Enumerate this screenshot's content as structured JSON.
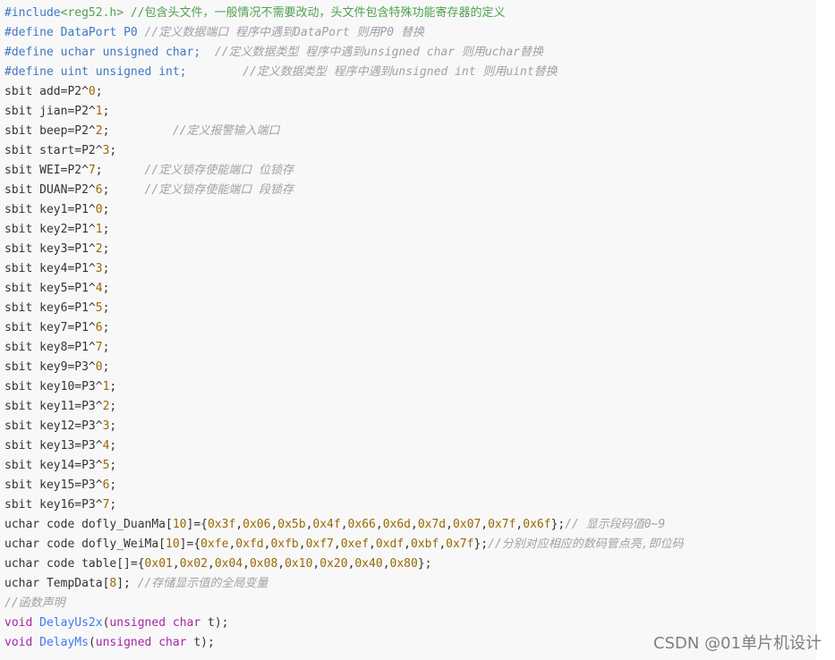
{
  "code_lines": [
    [
      {
        "t": "#include",
        "c": "dir"
      },
      {
        "t": "<reg52.h>",
        "c": "str"
      },
      {
        "t": " //包含头文件，一般情况不需要改动，头文件包含特殊功能寄存器的定义",
        "c": "str"
      }
    ],
    [
      {
        "t": "#define",
        "c": "dir"
      },
      {
        "t": " DataPort P0 ",
        "c": "kw"
      },
      {
        "t": "//定义数据端口 程序中遇到DataPort 则用P0 替换",
        "c": "cmt"
      }
    ],
    [
      {
        "t": "#define",
        "c": "dir"
      },
      {
        "t": " uchar unsigned char;",
        "c": "kw"
      },
      {
        "t": "  //定义数据类型 程序中遇到unsigned char 则用uchar替换",
        "c": "cmt"
      }
    ],
    [
      {
        "t": "#define",
        "c": "dir"
      },
      {
        "t": " uint unsigned int;",
        "c": "kw"
      },
      {
        "t": "        //定义数据类型 程序中遇到unsigned int 则用uint替换",
        "c": "cmt"
      }
    ],
    [
      {
        "t": "sbit add=P2^",
        "c": "sym"
      },
      {
        "t": "0",
        "c": "num"
      },
      {
        "t": ";",
        "c": "sym"
      }
    ],
    [
      {
        "t": "sbit jian=P2^",
        "c": "sym"
      },
      {
        "t": "1",
        "c": "num"
      },
      {
        "t": ";",
        "c": "sym"
      }
    ],
    [
      {
        "t": "sbit beep=P2^",
        "c": "sym"
      },
      {
        "t": "2",
        "c": "num"
      },
      {
        "t": ";",
        "c": "sym"
      },
      {
        "t": "         //定义报警输入端口",
        "c": "cmt"
      }
    ],
    [
      {
        "t": "sbit start=P2^",
        "c": "sym"
      },
      {
        "t": "3",
        "c": "num"
      },
      {
        "t": ";",
        "c": "sym"
      }
    ],
    [
      {
        "t": "sbit WEI=P2^",
        "c": "sym"
      },
      {
        "t": "7",
        "c": "num"
      },
      {
        "t": ";",
        "c": "sym"
      },
      {
        "t": "      //定义锁存使能端口 位锁存",
        "c": "cmt"
      }
    ],
    [
      {
        "t": "sbit DUAN=P2^",
        "c": "sym"
      },
      {
        "t": "6",
        "c": "num"
      },
      {
        "t": ";",
        "c": "sym"
      },
      {
        "t": "     //定义锁存使能端口 段锁存",
        "c": "cmt"
      }
    ],
    [
      {
        "t": "sbit key1=P1^",
        "c": "sym"
      },
      {
        "t": "0",
        "c": "num"
      },
      {
        "t": ";",
        "c": "sym"
      }
    ],
    [
      {
        "t": "sbit key2=P1^",
        "c": "sym"
      },
      {
        "t": "1",
        "c": "num"
      },
      {
        "t": ";",
        "c": "sym"
      }
    ],
    [
      {
        "t": "sbit key3=P1^",
        "c": "sym"
      },
      {
        "t": "2",
        "c": "num"
      },
      {
        "t": ";",
        "c": "sym"
      }
    ],
    [
      {
        "t": "sbit key4=P1^",
        "c": "sym"
      },
      {
        "t": "3",
        "c": "num"
      },
      {
        "t": ";",
        "c": "sym"
      }
    ],
    [
      {
        "t": "sbit key5=P1^",
        "c": "sym"
      },
      {
        "t": "4",
        "c": "num"
      },
      {
        "t": ";",
        "c": "sym"
      }
    ],
    [
      {
        "t": "sbit key6=P1^",
        "c": "sym"
      },
      {
        "t": "5",
        "c": "num"
      },
      {
        "t": ";",
        "c": "sym"
      }
    ],
    [
      {
        "t": "sbit key7=P1^",
        "c": "sym"
      },
      {
        "t": "6",
        "c": "num"
      },
      {
        "t": ";",
        "c": "sym"
      }
    ],
    [
      {
        "t": "sbit key8=P1^",
        "c": "sym"
      },
      {
        "t": "7",
        "c": "num"
      },
      {
        "t": ";",
        "c": "sym"
      }
    ],
    [
      {
        "t": "sbit key9=P3^",
        "c": "sym"
      },
      {
        "t": "0",
        "c": "num"
      },
      {
        "t": ";",
        "c": "sym"
      }
    ],
    [
      {
        "t": "sbit key10=P3^",
        "c": "sym"
      },
      {
        "t": "1",
        "c": "num"
      },
      {
        "t": ";",
        "c": "sym"
      }
    ],
    [
      {
        "t": "sbit key11=P3^",
        "c": "sym"
      },
      {
        "t": "2",
        "c": "num"
      },
      {
        "t": ";",
        "c": "sym"
      }
    ],
    [
      {
        "t": "sbit key12=P3^",
        "c": "sym"
      },
      {
        "t": "3",
        "c": "num"
      },
      {
        "t": ";",
        "c": "sym"
      }
    ],
    [
      {
        "t": "sbit key13=P3^",
        "c": "sym"
      },
      {
        "t": "4",
        "c": "num"
      },
      {
        "t": ";",
        "c": "sym"
      }
    ],
    [
      {
        "t": "sbit key14=P3^",
        "c": "sym"
      },
      {
        "t": "5",
        "c": "num"
      },
      {
        "t": ";",
        "c": "sym"
      }
    ],
    [
      {
        "t": "sbit key15=P3^",
        "c": "sym"
      },
      {
        "t": "6",
        "c": "num"
      },
      {
        "t": ";",
        "c": "sym"
      }
    ],
    [
      {
        "t": "sbit key16=P3^",
        "c": "sym"
      },
      {
        "t": "7",
        "c": "num"
      },
      {
        "t": ";",
        "c": "sym"
      }
    ],
    [
      {
        "t": "uchar code dofly_DuanMa[",
        "c": "sym"
      },
      {
        "t": "10",
        "c": "num"
      },
      {
        "t": "]={",
        "c": "sym"
      },
      {
        "t": "0x3f",
        "c": "num"
      },
      {
        "t": ",",
        "c": "sym"
      },
      {
        "t": "0x06",
        "c": "num"
      },
      {
        "t": ",",
        "c": "sym"
      },
      {
        "t": "0x5b",
        "c": "num"
      },
      {
        "t": ",",
        "c": "sym"
      },
      {
        "t": "0x4f",
        "c": "num"
      },
      {
        "t": ",",
        "c": "sym"
      },
      {
        "t": "0x66",
        "c": "num"
      },
      {
        "t": ",",
        "c": "sym"
      },
      {
        "t": "0x6d",
        "c": "num"
      },
      {
        "t": ",",
        "c": "sym"
      },
      {
        "t": "0x7d",
        "c": "num"
      },
      {
        "t": ",",
        "c": "sym"
      },
      {
        "t": "0x07",
        "c": "num"
      },
      {
        "t": ",",
        "c": "sym"
      },
      {
        "t": "0x7f",
        "c": "num"
      },
      {
        "t": ",",
        "c": "sym"
      },
      {
        "t": "0x6f",
        "c": "num"
      },
      {
        "t": "};",
        "c": "sym"
      },
      {
        "t": "// 显示段码值0~9",
        "c": "cmt"
      }
    ],
    [
      {
        "t": "uchar code dofly_WeiMa[",
        "c": "sym"
      },
      {
        "t": "10",
        "c": "num"
      },
      {
        "t": "]={",
        "c": "sym"
      },
      {
        "t": "0xfe",
        "c": "num"
      },
      {
        "t": ",",
        "c": "sym"
      },
      {
        "t": "0xfd",
        "c": "num"
      },
      {
        "t": ",",
        "c": "sym"
      },
      {
        "t": "0xfb",
        "c": "num"
      },
      {
        "t": ",",
        "c": "sym"
      },
      {
        "t": "0xf7",
        "c": "num"
      },
      {
        "t": ",",
        "c": "sym"
      },
      {
        "t": "0xef",
        "c": "num"
      },
      {
        "t": ",",
        "c": "sym"
      },
      {
        "t": "0xdf",
        "c": "num"
      },
      {
        "t": ",",
        "c": "sym"
      },
      {
        "t": "0xbf",
        "c": "num"
      },
      {
        "t": ",",
        "c": "sym"
      },
      {
        "t": "0x7f",
        "c": "num"
      },
      {
        "t": "};",
        "c": "sym"
      },
      {
        "t": "//分别对应相应的数码管点亮,即位码",
        "c": "cmt"
      }
    ],
    [
      {
        "t": "uchar code table[]={",
        "c": "sym"
      },
      {
        "t": "0x01",
        "c": "num"
      },
      {
        "t": ",",
        "c": "sym"
      },
      {
        "t": "0x02",
        "c": "num"
      },
      {
        "t": ",",
        "c": "sym"
      },
      {
        "t": "0x04",
        "c": "num"
      },
      {
        "t": ",",
        "c": "sym"
      },
      {
        "t": "0x08",
        "c": "num"
      },
      {
        "t": ",",
        "c": "sym"
      },
      {
        "t": "0x10",
        "c": "num"
      },
      {
        "t": ",",
        "c": "sym"
      },
      {
        "t": "0x20",
        "c": "num"
      },
      {
        "t": ",",
        "c": "sym"
      },
      {
        "t": "0x40",
        "c": "num"
      },
      {
        "t": ",",
        "c": "sym"
      },
      {
        "t": "0x80",
        "c": "num"
      },
      {
        "t": "};",
        "c": "sym"
      }
    ],
    [
      {
        "t": "uchar TempData[",
        "c": "sym"
      },
      {
        "t": "8",
        "c": "num"
      },
      {
        "t": "]; ",
        "c": "sym"
      },
      {
        "t": "//存储显示值的全局变量",
        "c": "cmt"
      }
    ],
    [
      {
        "t": "//函数声明",
        "c": "cmt"
      }
    ],
    [
      {
        "t": "void",
        "c": "type"
      },
      {
        "t": " ",
        "c": "sym"
      },
      {
        "t": "DelayUs2x",
        "c": "fn"
      },
      {
        "t": "(",
        "c": "sym"
      },
      {
        "t": "unsigned char",
        "c": "type"
      },
      {
        "t": " t);",
        "c": "sym"
      }
    ],
    [
      {
        "t": "void",
        "c": "type"
      },
      {
        "t": " ",
        "c": "sym"
      },
      {
        "t": "DelayMs",
        "c": "fn"
      },
      {
        "t": "(",
        "c": "sym"
      },
      {
        "t": "unsigned char",
        "c": "type"
      },
      {
        "t": " t);",
        "c": "sym"
      }
    ]
  ],
  "watermark": "CSDN @01单片机设计"
}
